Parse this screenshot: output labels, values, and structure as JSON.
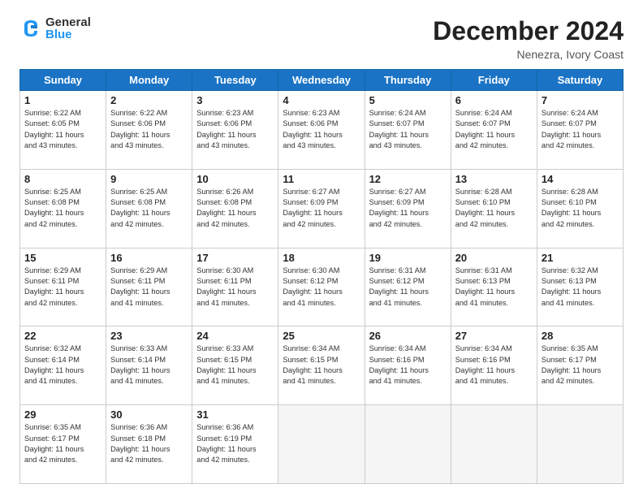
{
  "header": {
    "logo_general": "General",
    "logo_blue": "Blue",
    "month_title": "December 2024",
    "location": "Nenezra, Ivory Coast"
  },
  "weekdays": [
    "Sunday",
    "Monday",
    "Tuesday",
    "Wednesday",
    "Thursday",
    "Friday",
    "Saturday"
  ],
  "weeks": [
    [
      {
        "day": "1",
        "info": "Sunrise: 6:22 AM\nSunset: 6:05 PM\nDaylight: 11 hours\nand 43 minutes."
      },
      {
        "day": "2",
        "info": "Sunrise: 6:22 AM\nSunset: 6:06 PM\nDaylight: 11 hours\nand 43 minutes."
      },
      {
        "day": "3",
        "info": "Sunrise: 6:23 AM\nSunset: 6:06 PM\nDaylight: 11 hours\nand 43 minutes."
      },
      {
        "day": "4",
        "info": "Sunrise: 6:23 AM\nSunset: 6:06 PM\nDaylight: 11 hours\nand 43 minutes."
      },
      {
        "day": "5",
        "info": "Sunrise: 6:24 AM\nSunset: 6:07 PM\nDaylight: 11 hours\nand 43 minutes."
      },
      {
        "day": "6",
        "info": "Sunrise: 6:24 AM\nSunset: 6:07 PM\nDaylight: 11 hours\nand 42 minutes."
      },
      {
        "day": "7",
        "info": "Sunrise: 6:24 AM\nSunset: 6:07 PM\nDaylight: 11 hours\nand 42 minutes."
      }
    ],
    [
      {
        "day": "8",
        "info": "Sunrise: 6:25 AM\nSunset: 6:08 PM\nDaylight: 11 hours\nand 42 minutes."
      },
      {
        "day": "9",
        "info": "Sunrise: 6:25 AM\nSunset: 6:08 PM\nDaylight: 11 hours\nand 42 minutes."
      },
      {
        "day": "10",
        "info": "Sunrise: 6:26 AM\nSunset: 6:08 PM\nDaylight: 11 hours\nand 42 minutes."
      },
      {
        "day": "11",
        "info": "Sunrise: 6:27 AM\nSunset: 6:09 PM\nDaylight: 11 hours\nand 42 minutes."
      },
      {
        "day": "12",
        "info": "Sunrise: 6:27 AM\nSunset: 6:09 PM\nDaylight: 11 hours\nand 42 minutes."
      },
      {
        "day": "13",
        "info": "Sunrise: 6:28 AM\nSunset: 6:10 PM\nDaylight: 11 hours\nand 42 minutes."
      },
      {
        "day": "14",
        "info": "Sunrise: 6:28 AM\nSunset: 6:10 PM\nDaylight: 11 hours\nand 42 minutes."
      }
    ],
    [
      {
        "day": "15",
        "info": "Sunrise: 6:29 AM\nSunset: 6:11 PM\nDaylight: 11 hours\nand 42 minutes."
      },
      {
        "day": "16",
        "info": "Sunrise: 6:29 AM\nSunset: 6:11 PM\nDaylight: 11 hours\nand 41 minutes."
      },
      {
        "day": "17",
        "info": "Sunrise: 6:30 AM\nSunset: 6:11 PM\nDaylight: 11 hours\nand 41 minutes."
      },
      {
        "day": "18",
        "info": "Sunrise: 6:30 AM\nSunset: 6:12 PM\nDaylight: 11 hours\nand 41 minutes."
      },
      {
        "day": "19",
        "info": "Sunrise: 6:31 AM\nSunset: 6:12 PM\nDaylight: 11 hours\nand 41 minutes."
      },
      {
        "day": "20",
        "info": "Sunrise: 6:31 AM\nSunset: 6:13 PM\nDaylight: 11 hours\nand 41 minutes."
      },
      {
        "day": "21",
        "info": "Sunrise: 6:32 AM\nSunset: 6:13 PM\nDaylight: 11 hours\nand 41 minutes."
      }
    ],
    [
      {
        "day": "22",
        "info": "Sunrise: 6:32 AM\nSunset: 6:14 PM\nDaylight: 11 hours\nand 41 minutes."
      },
      {
        "day": "23",
        "info": "Sunrise: 6:33 AM\nSunset: 6:14 PM\nDaylight: 11 hours\nand 41 minutes."
      },
      {
        "day": "24",
        "info": "Sunrise: 6:33 AM\nSunset: 6:15 PM\nDaylight: 11 hours\nand 41 minutes."
      },
      {
        "day": "25",
        "info": "Sunrise: 6:34 AM\nSunset: 6:15 PM\nDaylight: 11 hours\nand 41 minutes."
      },
      {
        "day": "26",
        "info": "Sunrise: 6:34 AM\nSunset: 6:16 PM\nDaylight: 11 hours\nand 41 minutes."
      },
      {
        "day": "27",
        "info": "Sunrise: 6:34 AM\nSunset: 6:16 PM\nDaylight: 11 hours\nand 41 minutes."
      },
      {
        "day": "28",
        "info": "Sunrise: 6:35 AM\nSunset: 6:17 PM\nDaylight: 11 hours\nand 42 minutes."
      }
    ],
    [
      {
        "day": "29",
        "info": "Sunrise: 6:35 AM\nSunset: 6:17 PM\nDaylight: 11 hours\nand 42 minutes."
      },
      {
        "day": "30",
        "info": "Sunrise: 6:36 AM\nSunset: 6:18 PM\nDaylight: 11 hours\nand 42 minutes."
      },
      {
        "day": "31",
        "info": "Sunrise: 6:36 AM\nSunset: 6:19 PM\nDaylight: 11 hours\nand 42 minutes."
      },
      null,
      null,
      null,
      null
    ]
  ]
}
